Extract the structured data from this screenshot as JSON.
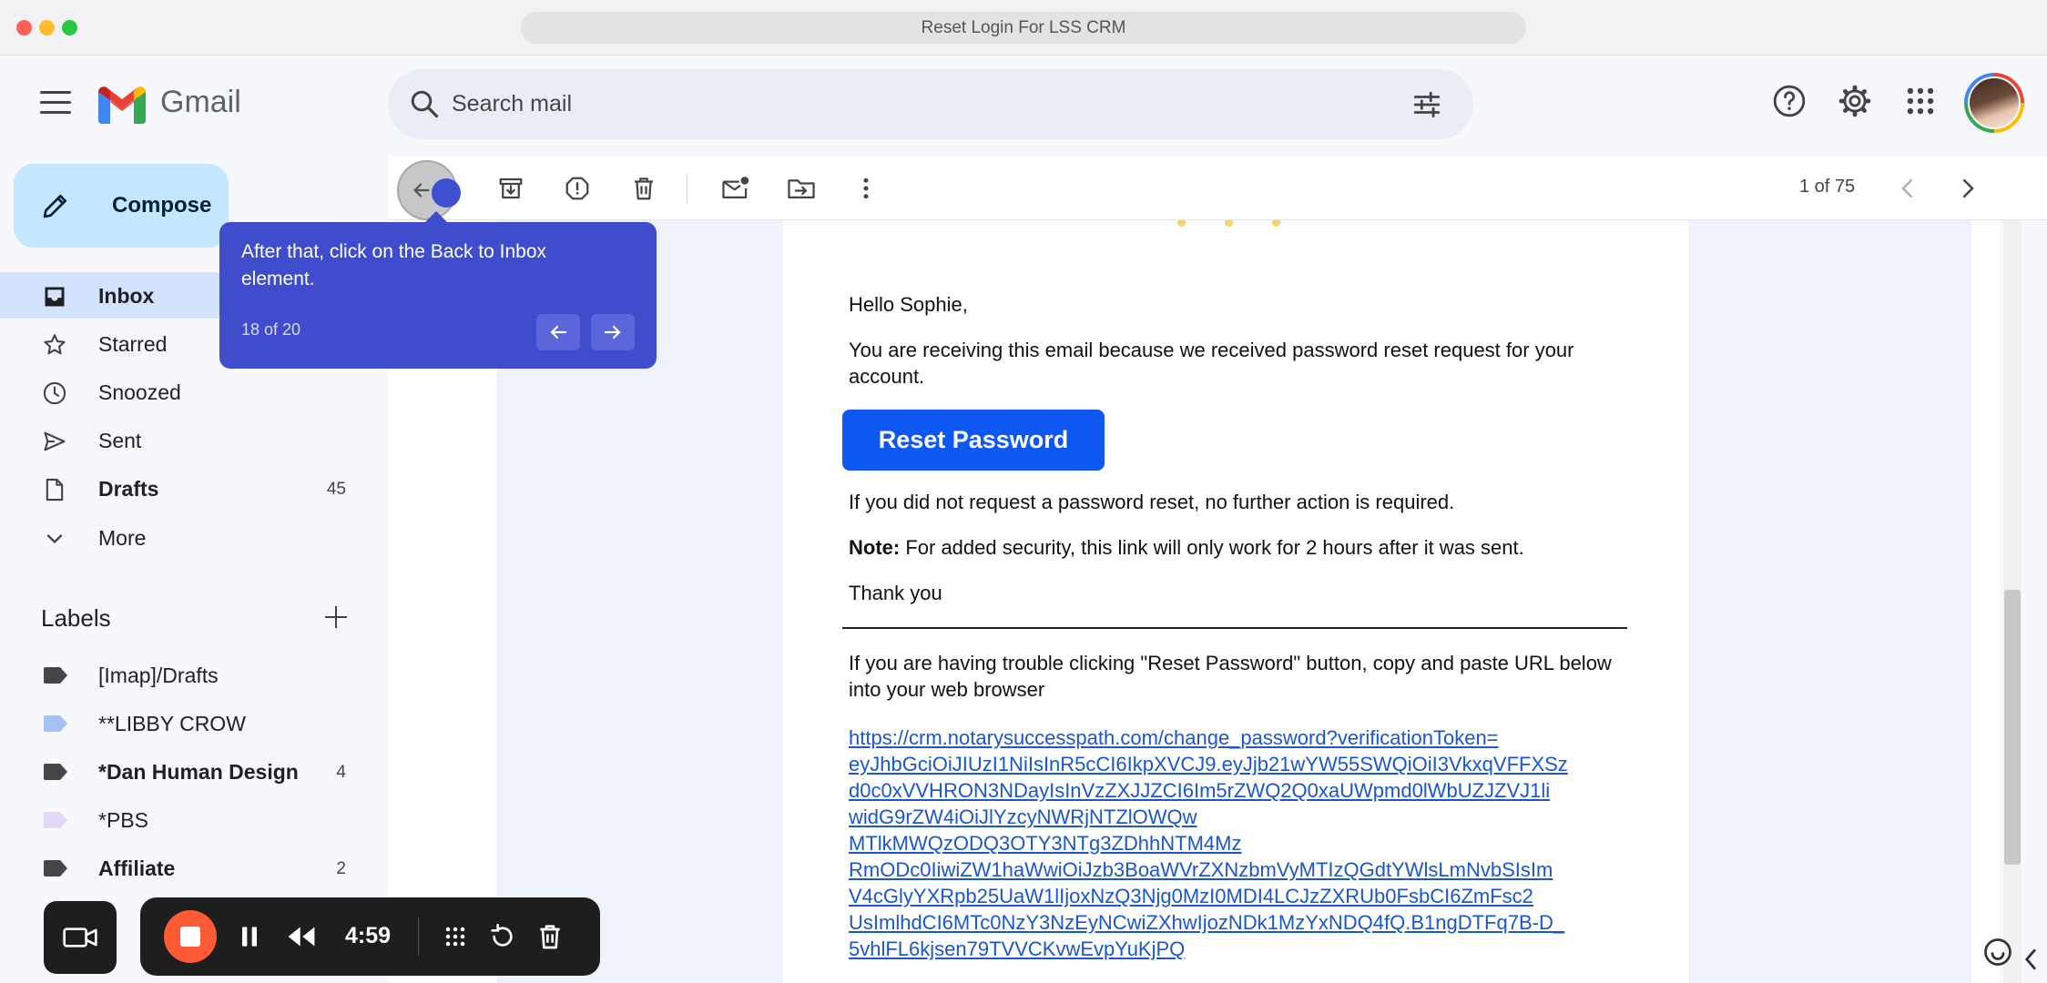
{
  "window": {
    "title": "Reset Login For LSS CRM"
  },
  "header": {
    "logo_text": "Gmail",
    "search_placeholder": "Search mail"
  },
  "sidebar": {
    "compose_label": "Compose",
    "items": [
      {
        "label": "Inbox",
        "count": "",
        "icon": "inbox-icon"
      },
      {
        "label": "Starred",
        "count": "",
        "icon": "star-icon"
      },
      {
        "label": "Snoozed",
        "count": "",
        "icon": "clock-icon"
      },
      {
        "label": "Sent",
        "count": "",
        "icon": "send-icon"
      },
      {
        "label": "Drafts",
        "count": "45",
        "icon": "draft-icon"
      },
      {
        "label": "More",
        "count": "",
        "icon": "chevron-down-icon"
      }
    ],
    "labels_heading": "Labels",
    "labels": [
      {
        "label": "[Imap]/Drafts",
        "count": "",
        "color": "#444746"
      },
      {
        "label": "**LIBBY CROW",
        "count": "",
        "color": "#a4c2f4"
      },
      {
        "label": "*Dan Human Design",
        "count": "4",
        "color": "#444746"
      },
      {
        "label": "*PBS",
        "count": "",
        "color": "#e4d7f5"
      },
      {
        "label": "Affiliate",
        "count": "2",
        "color": "#444746"
      }
    ]
  },
  "toolbar": {
    "pager": "1 of 75"
  },
  "tooltip": {
    "message": "After that, click on the Back to Inbox element.",
    "step": "18 of 20"
  },
  "email": {
    "greeting": "Hello Sophie,",
    "intro": "You are receiving this email because we received password reset request for your account.",
    "button_label": "Reset Password",
    "no_action": "If you did not request a password reset, no further action is required.",
    "note_label": "Note:",
    "note_text": " For added security, this link will only work for 2 hours after it was sent.",
    "thanks": "Thank you",
    "trouble": "If you are having trouble clicking \"Reset Password\" button, copy and paste URL below into your web browser",
    "link_lines": [
      "https://crm.notarysuccesspath.com/change_password?verificationToken=",
      "eyJhbGciOiJIUzI1NiIsInR5cCI6IkpXVCJ9.eyJjb21wYW55SWQiOiI3VkxqVFFXSz",
      "d0c0xVVHRON3NDayIsInVzZXJJZCI6Im5rZWQ2Q0xaUWpmd0lWbUZJZVJ1li",
      "widG9rZW4iOiJlYzcyNWRjNTZlOWQw",
      "MTlkMWQzODQ3OTY3NTg3ZDhhNTM4Mz",
      "RmODc0IiwiZW1haWwiOiJzb3BoaWVrZXNzbmVyMTIzQGdtYWlsLmNvbSIsIm",
      "V4cGlyYXRpb25UaW1lIjoxNzQ3Njg0MzI0MDI4LCJzZXRUb0FsbCI6ZmFsc2",
      "UsImlhdCI6MTc0NzY3NzEyNCwiZXhwIjozNDk1MzYxNDQ4fQ.B1ngDTFq7B-D_",
      "5vhlFL6kjsen79TVVCKvwEvpYuKjPQ"
    ]
  },
  "recorder": {
    "time": "4:59"
  },
  "colors": {
    "accent": "#0b57d0",
    "tooltip": "#3f4ccc",
    "reset_button": "#0d58f2",
    "record": "#ff5a36"
  }
}
